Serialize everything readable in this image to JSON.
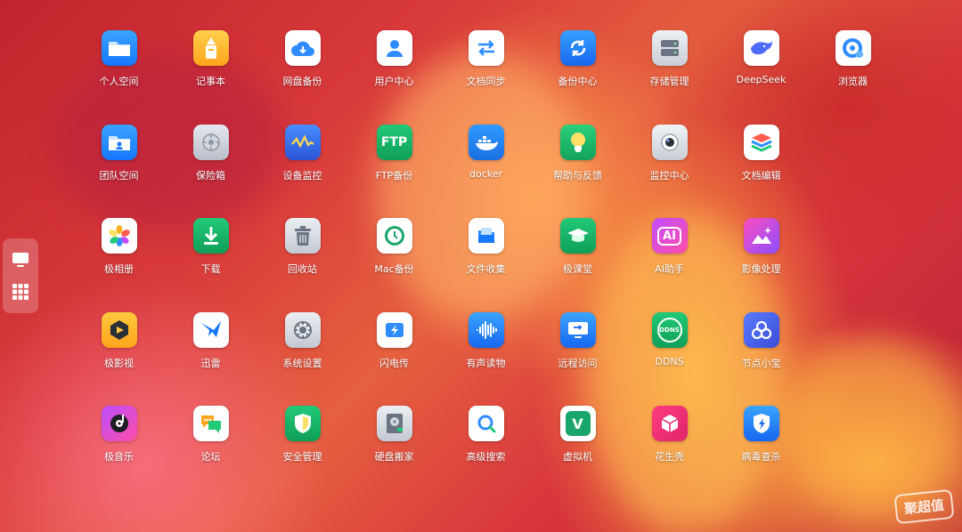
{
  "apps": [
    {
      "label": "个人空间",
      "icon": "folder-icon"
    },
    {
      "label": "记事本",
      "icon": "notepad-icon"
    },
    {
      "label": "网盘备份",
      "icon": "cloud-upload-icon"
    },
    {
      "label": "用户中心",
      "icon": "user-icon"
    },
    {
      "label": "文档同步",
      "icon": "sync-arrows-icon"
    },
    {
      "label": "备份中心",
      "icon": "refresh-icon"
    },
    {
      "label": "存储管理",
      "icon": "storage-icon"
    },
    {
      "label": "DeepSeek",
      "icon": "whale-icon"
    },
    {
      "label": "浏览器",
      "icon": "browser-icon"
    },
    {
      "label": "团队空间",
      "icon": "team-folder-icon"
    },
    {
      "label": "保险箱",
      "icon": "safe-icon"
    },
    {
      "label": "设备监控",
      "icon": "waveform-monitor-icon"
    },
    {
      "label": "FTP备份",
      "icon": "ftp-icon"
    },
    {
      "label": "docker",
      "icon": "docker-icon"
    },
    {
      "label": "帮助与反馈",
      "icon": "lightbulb-icon"
    },
    {
      "label": "监控中心",
      "icon": "camera-icon"
    },
    {
      "label": "文档编辑",
      "icon": "layers-icon"
    },
    {
      "label": "极相册",
      "icon": "photos-flower-icon"
    },
    {
      "label": "下载",
      "icon": "download-icon"
    },
    {
      "label": "回收站",
      "icon": "trash-icon"
    },
    {
      "label": "Mac备份",
      "icon": "time-machine-icon"
    },
    {
      "label": "文件收集",
      "icon": "file-collect-icon"
    },
    {
      "label": "极课堂",
      "icon": "graduation-cap-icon"
    },
    {
      "label": "AI助手",
      "icon": "ai-assistant-icon"
    },
    {
      "label": "影像处理",
      "icon": "image-edit-icon"
    },
    {
      "label": "极影视",
      "icon": "video-icon"
    },
    {
      "label": "迅雷",
      "icon": "thunder-bird-icon"
    },
    {
      "label": "系统设置",
      "icon": "gear-icon"
    },
    {
      "label": "闪电传",
      "icon": "lightning-transfer-icon"
    },
    {
      "label": "有声读物",
      "icon": "audio-wave-icon"
    },
    {
      "label": "远程访问",
      "icon": "remote-desktop-icon"
    },
    {
      "label": "DDNS",
      "icon": "ddns-globe-icon"
    },
    {
      "label": "节点小宝",
      "icon": "node-icon"
    },
    {
      "label": "极音乐",
      "icon": "music-disc-icon"
    },
    {
      "label": "论坛",
      "icon": "chat-bubbles-icon"
    },
    {
      "label": "安全管理",
      "icon": "shield-check-icon"
    },
    {
      "label": "硬盘搬家",
      "icon": "hard-drive-icon"
    },
    {
      "label": "高级搜索",
      "icon": "search-icon"
    },
    {
      "label": "虚拟机",
      "icon": "vm-icon"
    },
    {
      "label": "花生壳",
      "icon": "peanut-shell-icon"
    },
    {
      "label": "病毒查杀",
      "icon": "antivirus-shield-icon"
    }
  ],
  "icon_glyphs": {
    "FTP备份": "FTP",
    "AI助手": "AI",
    "DDNS": "DDNS",
    "虚拟机": "V"
  },
  "watermark": "聚超值",
  "colors": {
    "wallpaper_red": "#c2242e",
    "wallpaper_orange": "#ffb03c",
    "sidebar_bg": "rgba(255,255,255,0.22)",
    "label_text": "#ffffff"
  }
}
